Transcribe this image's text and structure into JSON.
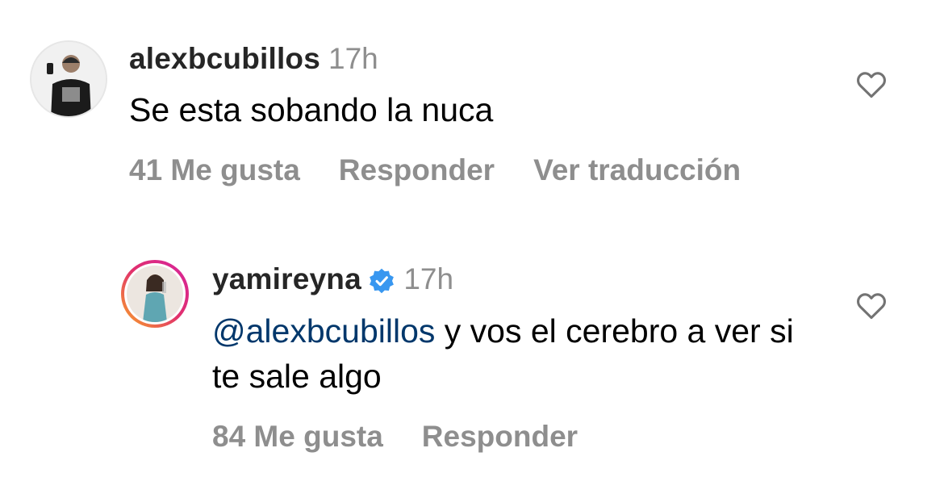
{
  "comments": [
    {
      "username": "alexbcubillos",
      "time": "17h",
      "text": "Se esta sobando la nuca",
      "likes_label": "41 Me gusta",
      "reply_label": "Responder",
      "translate_label": "Ver traducción"
    },
    {
      "username": "yamireyna",
      "verified": true,
      "time": "17h",
      "mention": "@alexbcubillos",
      "text": " y vos el cerebro a ver si te sale algo",
      "likes_label": "84 Me gusta",
      "reply_label": "Responder"
    }
  ],
  "colors": {
    "username": "#262626",
    "secondary": "#8e8e8e",
    "mention": "#00376b",
    "verified": "#3897f0",
    "story_ring_start": "#f9a825",
    "story_ring_end": "#d6249f"
  },
  "icons": [
    "heart-outline-icon",
    "verified-badge-icon"
  ]
}
